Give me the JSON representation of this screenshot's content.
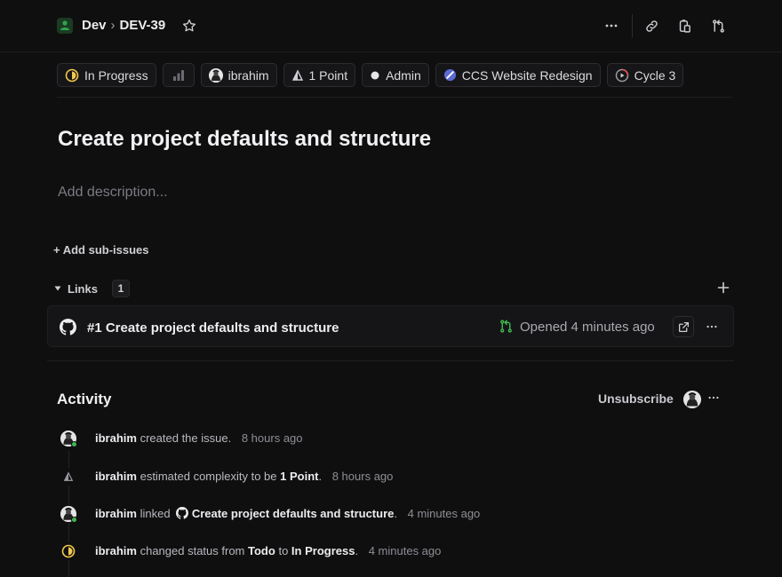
{
  "header": {
    "team": "Dev",
    "separator": "›",
    "issue_id": "DEV-39",
    "colors": {
      "team_icon": "#2fa44f"
    }
  },
  "properties": [
    {
      "name": "status",
      "label": "In Progress",
      "icon": "in-progress-icon",
      "color": "#f2c94c"
    },
    {
      "name": "priority",
      "label": "",
      "icon": "priority-bars-icon"
    },
    {
      "name": "assignee",
      "label": "ibrahim",
      "icon": "avatar"
    },
    {
      "name": "estimate",
      "label": "1 Point",
      "icon": "estimate-icon"
    },
    {
      "name": "label",
      "label": "Admin",
      "icon": "label-dot-icon",
      "color": "#e6e6e6"
    },
    {
      "name": "project",
      "label": "CCS Website Redesign",
      "icon": "project-icon",
      "color": "#5e6ad2"
    },
    {
      "name": "cycle",
      "label": "Cycle 3",
      "icon": "cycle-icon",
      "color": "#eb5757"
    }
  ],
  "issue": {
    "title": "Create project defaults and structure",
    "description_placeholder": "Add description..."
  },
  "sub_issues": {
    "add_label": "+ Add sub-issues"
  },
  "links": {
    "label": "Links",
    "count": "1",
    "items": [
      {
        "title": "#1 Create project defaults and structure",
        "status": "Opened 4 minutes ago",
        "status_color": "#3fb950"
      }
    ]
  },
  "activity": {
    "title": "Activity",
    "unsubscribe_label": "Unsubscribe",
    "entries": [
      {
        "actor": "ibrahim",
        "action": "created the issue.",
        "time": "8 hours ago"
      },
      {
        "actor": "ibrahim",
        "action": "estimated complexity to be",
        "value": "1 Point",
        "suffix": ".",
        "time": "8 hours ago"
      },
      {
        "actor": "ibrahim",
        "action": "linked",
        "value": "Create project defaults and structure",
        "suffix": ".",
        "time": "4 minutes ago"
      },
      {
        "actor": "ibrahim",
        "action": "changed status from",
        "from": "Todo",
        "to_word": "to",
        "to": "In Progress",
        "suffix": ".",
        "time": "4 minutes ago"
      }
    ]
  }
}
